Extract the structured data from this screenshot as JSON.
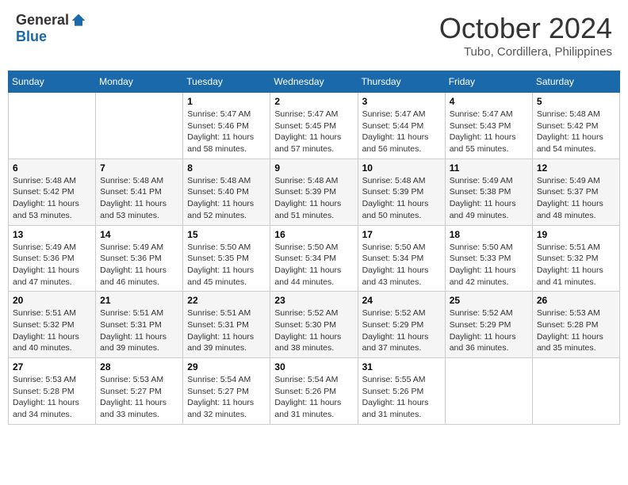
{
  "header": {
    "logo": {
      "text_general": "General",
      "text_blue": "Blue",
      "tagline": "GeneralBlue"
    },
    "title": "October 2024",
    "location": "Tubo, Cordillera, Philippines"
  },
  "weekdays": [
    "Sunday",
    "Monday",
    "Tuesday",
    "Wednesday",
    "Thursday",
    "Friday",
    "Saturday"
  ],
  "weeks": [
    [
      {
        "day": "",
        "info": ""
      },
      {
        "day": "",
        "info": ""
      },
      {
        "day": "1",
        "info": "Sunrise: 5:47 AM\nSunset: 5:46 PM\nDaylight: 11 hours and 58 minutes."
      },
      {
        "day": "2",
        "info": "Sunrise: 5:47 AM\nSunset: 5:45 PM\nDaylight: 11 hours and 57 minutes."
      },
      {
        "day": "3",
        "info": "Sunrise: 5:47 AM\nSunset: 5:44 PM\nDaylight: 11 hours and 56 minutes."
      },
      {
        "day": "4",
        "info": "Sunrise: 5:47 AM\nSunset: 5:43 PM\nDaylight: 11 hours and 55 minutes."
      },
      {
        "day": "5",
        "info": "Sunrise: 5:48 AM\nSunset: 5:42 PM\nDaylight: 11 hours and 54 minutes."
      }
    ],
    [
      {
        "day": "6",
        "info": "Sunrise: 5:48 AM\nSunset: 5:42 PM\nDaylight: 11 hours and 53 minutes."
      },
      {
        "day": "7",
        "info": "Sunrise: 5:48 AM\nSunset: 5:41 PM\nDaylight: 11 hours and 53 minutes."
      },
      {
        "day": "8",
        "info": "Sunrise: 5:48 AM\nSunset: 5:40 PM\nDaylight: 11 hours and 52 minutes."
      },
      {
        "day": "9",
        "info": "Sunrise: 5:48 AM\nSunset: 5:39 PM\nDaylight: 11 hours and 51 minutes."
      },
      {
        "day": "10",
        "info": "Sunrise: 5:48 AM\nSunset: 5:39 PM\nDaylight: 11 hours and 50 minutes."
      },
      {
        "day": "11",
        "info": "Sunrise: 5:49 AM\nSunset: 5:38 PM\nDaylight: 11 hours and 49 minutes."
      },
      {
        "day": "12",
        "info": "Sunrise: 5:49 AM\nSunset: 5:37 PM\nDaylight: 11 hours and 48 minutes."
      }
    ],
    [
      {
        "day": "13",
        "info": "Sunrise: 5:49 AM\nSunset: 5:36 PM\nDaylight: 11 hours and 47 minutes."
      },
      {
        "day": "14",
        "info": "Sunrise: 5:49 AM\nSunset: 5:36 PM\nDaylight: 11 hours and 46 minutes."
      },
      {
        "day": "15",
        "info": "Sunrise: 5:50 AM\nSunset: 5:35 PM\nDaylight: 11 hours and 45 minutes."
      },
      {
        "day": "16",
        "info": "Sunrise: 5:50 AM\nSunset: 5:34 PM\nDaylight: 11 hours and 44 minutes."
      },
      {
        "day": "17",
        "info": "Sunrise: 5:50 AM\nSunset: 5:34 PM\nDaylight: 11 hours and 43 minutes."
      },
      {
        "day": "18",
        "info": "Sunrise: 5:50 AM\nSunset: 5:33 PM\nDaylight: 11 hours and 42 minutes."
      },
      {
        "day": "19",
        "info": "Sunrise: 5:51 AM\nSunset: 5:32 PM\nDaylight: 11 hours and 41 minutes."
      }
    ],
    [
      {
        "day": "20",
        "info": "Sunrise: 5:51 AM\nSunset: 5:32 PM\nDaylight: 11 hours and 40 minutes."
      },
      {
        "day": "21",
        "info": "Sunrise: 5:51 AM\nSunset: 5:31 PM\nDaylight: 11 hours and 39 minutes."
      },
      {
        "day": "22",
        "info": "Sunrise: 5:51 AM\nSunset: 5:31 PM\nDaylight: 11 hours and 39 minutes."
      },
      {
        "day": "23",
        "info": "Sunrise: 5:52 AM\nSunset: 5:30 PM\nDaylight: 11 hours and 38 minutes."
      },
      {
        "day": "24",
        "info": "Sunrise: 5:52 AM\nSunset: 5:29 PM\nDaylight: 11 hours and 37 minutes."
      },
      {
        "day": "25",
        "info": "Sunrise: 5:52 AM\nSunset: 5:29 PM\nDaylight: 11 hours and 36 minutes."
      },
      {
        "day": "26",
        "info": "Sunrise: 5:53 AM\nSunset: 5:28 PM\nDaylight: 11 hours and 35 minutes."
      }
    ],
    [
      {
        "day": "27",
        "info": "Sunrise: 5:53 AM\nSunset: 5:28 PM\nDaylight: 11 hours and 34 minutes."
      },
      {
        "day": "28",
        "info": "Sunrise: 5:53 AM\nSunset: 5:27 PM\nDaylight: 11 hours and 33 minutes."
      },
      {
        "day": "29",
        "info": "Sunrise: 5:54 AM\nSunset: 5:27 PM\nDaylight: 11 hours and 32 minutes."
      },
      {
        "day": "30",
        "info": "Sunrise: 5:54 AM\nSunset: 5:26 PM\nDaylight: 11 hours and 31 minutes."
      },
      {
        "day": "31",
        "info": "Sunrise: 5:55 AM\nSunset: 5:26 PM\nDaylight: 11 hours and 31 minutes."
      },
      {
        "day": "",
        "info": ""
      },
      {
        "day": "",
        "info": ""
      }
    ]
  ]
}
